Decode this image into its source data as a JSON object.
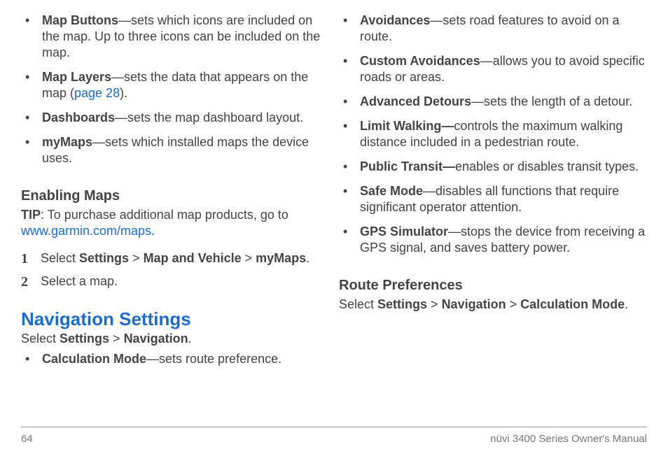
{
  "left": {
    "bullets": [
      {
        "term": "Map Buttons",
        "desc": "—sets which icons are included on the map. Up to three icons can be included on the map."
      },
      {
        "term": "Map Layers",
        "desc_before": "—sets the data that appears on the map (",
        "link": "page 28",
        "desc_after": ")."
      },
      {
        "term": "Dashboards",
        "desc": "—sets the map dashboard layout."
      },
      {
        "term": "myMaps",
        "desc": "—sets which installed maps the device uses."
      }
    ],
    "subhead": "Enabling Maps",
    "tip_label": "TIP",
    "tip_body_before": ": To purchase additional map products, go to ",
    "tip_link": "www.garmin.com/maps",
    "tip_body_after": ".",
    "steps": [
      {
        "pre": "Select ",
        "b1": "Settings",
        "m1": " > ",
        "b2": "Map and Vehicle",
        "m2": " > ",
        "b3": "myMaps",
        "post": "."
      },
      {
        "plain": "Select a map."
      }
    ],
    "h2": "Navigation Settings",
    "select_pre": "Select ",
    "select_b1": "Settings",
    "select_m1": " > ",
    "select_b2": "Navigation",
    "select_post": ".",
    "bullets2": [
      {
        "term": "Calculation Mode",
        "desc": "—sets route preference."
      }
    ]
  },
  "right": {
    "bullets": [
      {
        "term": "Avoidances",
        "desc": "—sets road features to avoid on a route."
      },
      {
        "term": "Custom Avoidances",
        "desc": "—allows you to avoid specific roads or areas."
      },
      {
        "term": "Advanced Detours",
        "desc": "—sets the length of a detour."
      },
      {
        "term": "Limit Walking—",
        "desc": "controls the maximum walking distance included in a pedestrian route."
      },
      {
        "term": "Public Transit—",
        "desc": "enables or disables transit types."
      },
      {
        "term": "Safe Mode",
        "desc": "—disables all functions that require significant operator attention."
      },
      {
        "term": "GPS Simulator",
        "desc": "—stops the device from receiving a GPS signal, and saves battery power."
      }
    ],
    "subhead": "Route Preferences",
    "select_pre": "Select ",
    "select_b1": "Settings",
    "select_m1": " > ",
    "select_b2": "Navigation",
    "select_m2": " > ",
    "select_b3": "Calculation Mode",
    "select_post": "."
  },
  "footer": {
    "page": "64",
    "manual": "nüvi 3400 Series Owner's Manual"
  }
}
